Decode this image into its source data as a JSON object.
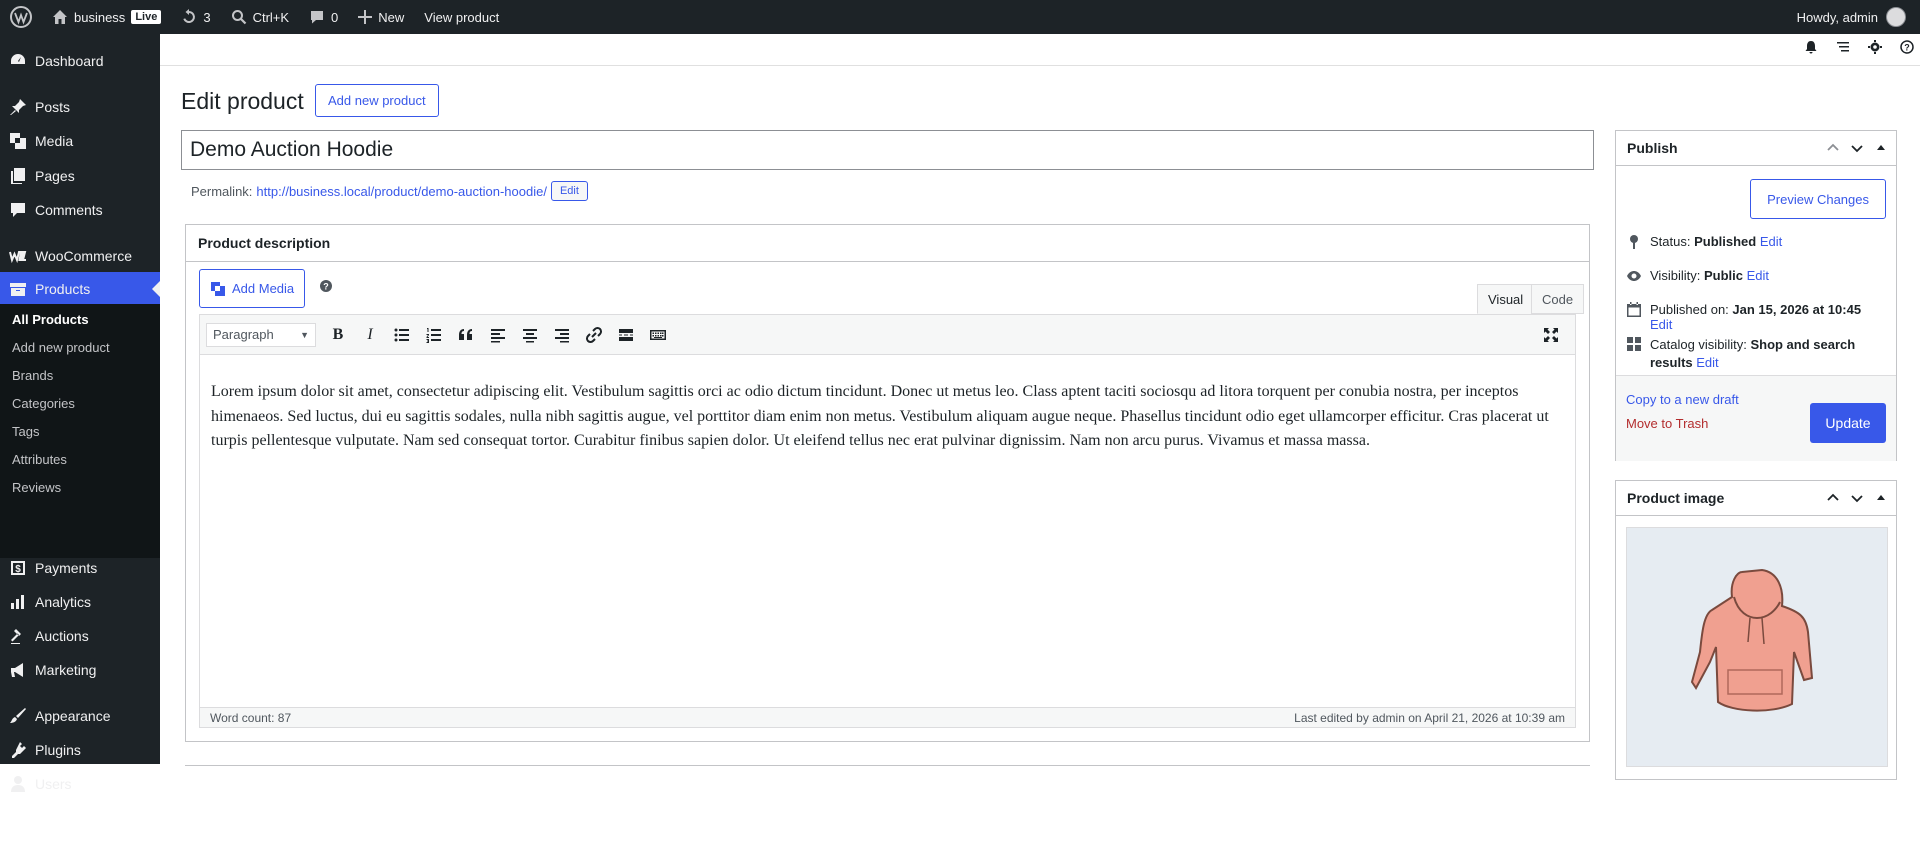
{
  "adminbar": {
    "site_name": "business",
    "live_label": "Live",
    "updates_count": "3",
    "search_shortcut": "Ctrl+K",
    "comments_count": "0",
    "new_label": "New",
    "view_product": "View product",
    "howdy": "Howdy, admin"
  },
  "sidebar": {
    "items": {
      "dashboard": "Dashboard",
      "posts": "Posts",
      "media": "Media",
      "pages": "Pages",
      "comments": "Comments",
      "woocommerce": "WooCommerce",
      "products": "Products",
      "payments": "Payments",
      "analytics": "Analytics",
      "auctions": "Auctions",
      "marketing": "Marketing",
      "appearance": "Appearance",
      "plugins": "Plugins",
      "users": "Users"
    },
    "submenu": {
      "all_products": "All Products",
      "add_new": "Add new product",
      "brands": "Brands",
      "categories": "Categories",
      "tags": "Tags",
      "attributes": "Attributes",
      "reviews": "Reviews"
    }
  },
  "page": {
    "title": "Edit product",
    "add_new_button": "Add new product",
    "product_title": "Demo Auction Hoodie",
    "permalink_label": "Permalink:",
    "permalink_base": "http://business.local/product/",
    "permalink_slug": "demo-auction-hoodie/",
    "permalink_edit": "Edit"
  },
  "description": {
    "header": "Product description",
    "add_media": "Add Media",
    "tab_visual": "Visual",
    "tab_code": "Code",
    "format_select": "Paragraph",
    "content": "Lorem ipsum dolor sit amet, consectetur adipiscing elit. Vestibulum sagittis orci ac odio dictum tincidunt. Donec ut metus leo. Class aptent taciti sociosqu ad litora torquent per conubia nostra, per inceptos himenaeos. Sed luctus, dui eu sagittis sodales, nulla nibh sagittis augue, vel porttitor diam enim non metus. Vestibulum aliquam augue neque. Phasellus tincidunt odio eget ullamcorper efficitur. Cras placerat ut turpis pellentesque vulputate. Nam sed consequat tortor. Curabitur finibus sapien dolor. Ut eleifend tellus nec erat pulvinar dignissim. Nam non arcu purus. Vivamus et massa massa.",
    "word_count": "Word count: 87",
    "last_edited": "Last edited by admin on April 21, 2026 at 10:39 am"
  },
  "publish": {
    "header": "Publish",
    "preview_button": "Preview Changes",
    "status_label": "Status:",
    "status_value": "Published",
    "visibility_label": "Visibility:",
    "visibility_value": "Public",
    "published_label": "Published on:",
    "published_value": "Jan 15, 2026 at 10:45",
    "catalog_label": "Catalog visibility:",
    "catalog_value": "Shop and search results",
    "edit_link": "Edit",
    "copy_draft": "Copy to a new draft",
    "move_trash": "Move to Trash",
    "update_button": "Update"
  },
  "product_image": {
    "header": "Product image"
  },
  "colors": {
    "accent": "#3858e9",
    "adminbar": "#1d2327",
    "trash": "#b32d2e",
    "hoodie": "#f0a090"
  }
}
